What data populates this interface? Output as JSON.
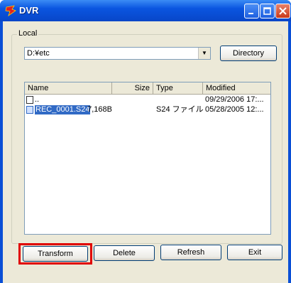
{
  "window": {
    "title": "DVR"
  },
  "local_group": {
    "label": "Local"
  },
  "path_combo": {
    "value": "D:¥etc"
  },
  "directory_button": {
    "label": "Directory"
  },
  "file_list": {
    "columns": [
      "Name",
      "Size",
      "Type",
      "Modified"
    ],
    "rows": [
      {
        "name": "..",
        "size": "",
        "type": "",
        "modified": "09/29/2006 17:..."
      },
      {
        "name": "REC_0001.S24",
        "size": "7,168B",
        "type": "S24 ファイル",
        "modified": "05/28/2005 12:..."
      }
    ]
  },
  "buttons": {
    "transform": "Transform",
    "delete": "Delete",
    "refresh": "Refresh",
    "exit": "Exit"
  },
  "colors": {
    "selection": "#316ac5",
    "highlight": "#e00000"
  }
}
